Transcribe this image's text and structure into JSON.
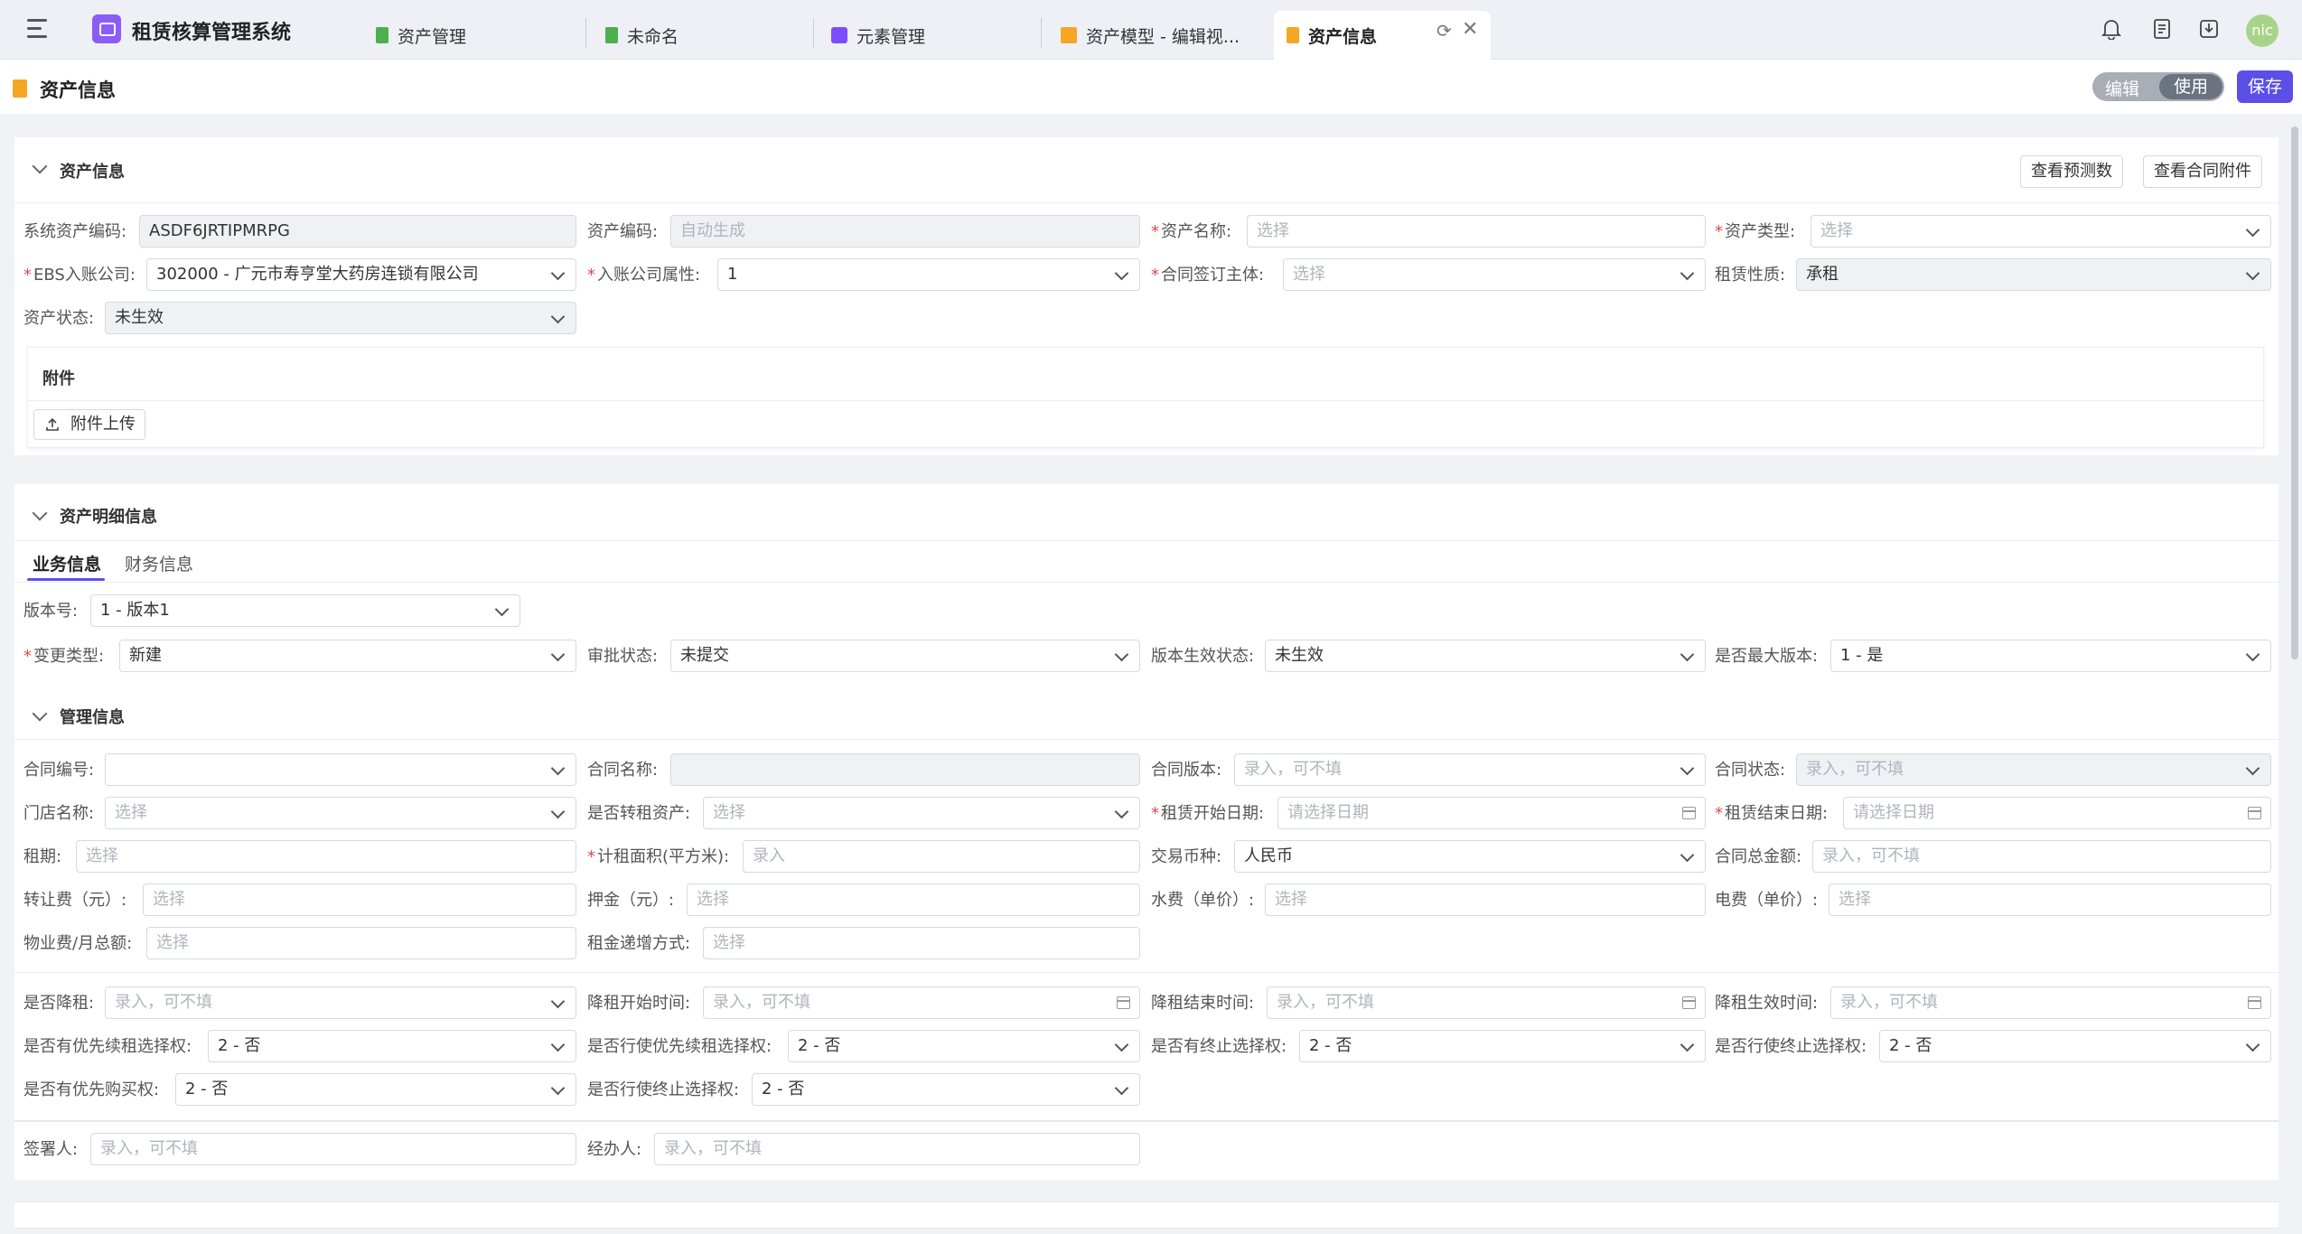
{
  "app": {
    "title": "租赁核算管理系统"
  },
  "tabs": [
    {
      "label": "资产管理",
      "color": "#4caf50"
    },
    {
      "label": "未命名",
      "color": "#4caf50"
    },
    {
      "label": "元素管理",
      "color": "#7c4dff"
    },
    {
      "label": "资产模型 - 编辑视...",
      "color": "#f5a623"
    },
    {
      "label": "资产信息",
      "color": "#f5a623"
    }
  ],
  "user": {
    "avatar": "nic"
  },
  "page": {
    "title": "资产信息",
    "mode_edit": "编辑",
    "mode_use": "使用",
    "save_label": "保存"
  },
  "asset_info": {
    "title": "资产信息",
    "btn_forecast": "查看预测数",
    "btn_contract_attach": "查看合同附件",
    "sys_code": {
      "label": "系统资产编码:",
      "value": "ASDF6JRTIPMRPG"
    },
    "asset_code": {
      "label": "资产编码:",
      "value": "自动生成"
    },
    "asset_name": {
      "label": "资产名称:",
      "value": "选择"
    },
    "asset_type": {
      "label": "资产类型:",
      "value": "选择"
    },
    "ebs_company": {
      "label": "EBS入账公司:",
      "value": "302000 - 广元市寿亨堂大药房连锁有限公司"
    },
    "company_attr": {
      "label": "入账公司属性:",
      "value": "1"
    },
    "contract_party": {
      "label": "合同签订主体:",
      "value": "选择"
    },
    "lease_nature": {
      "label": "租赁性质:",
      "value": "承租"
    },
    "asset_status": {
      "label": "资产状态:",
      "value": "未生效"
    },
    "attachment_title": "附件",
    "upload_label": "附件上传"
  },
  "detail": {
    "title": "资产明细信息",
    "tab_business": "业务信息",
    "tab_finance": "财务信息",
    "version": {
      "label": "版本号:",
      "value": "1 - 版本1"
    },
    "change_type": {
      "label": "变更类型:",
      "value": "新建"
    },
    "approval_status": {
      "label": "审批状态:",
      "value": "未提交"
    },
    "version_status": {
      "label": "版本生效状态:",
      "value": "未生效"
    },
    "is_max_version": {
      "label": "是否最大版本:",
      "value": "1 - 是"
    }
  },
  "mgmt": {
    "title": "管理信息",
    "contract_no": {
      "label": "合同编号:",
      "value": ""
    },
    "contract_name": {
      "label": "合同名称:",
      "value": ""
    },
    "contract_version": {
      "label": "合同版本:",
      "value": "录入，可不填"
    },
    "contract_status": {
      "label": "合同状态:",
      "value": "录入，可不填"
    },
    "store_name": {
      "label": "门店名称:",
      "value": "选择"
    },
    "is_sublease": {
      "label": "是否转租资产:",
      "value": "选择"
    },
    "lease_start": {
      "label": "租赁开始日期:",
      "value": "请选择日期"
    },
    "lease_end": {
      "label": "租赁结束日期:",
      "value": "请选择日期"
    },
    "lease_term": {
      "label": "租期:",
      "value": "选择"
    },
    "lease_area": {
      "label": "计租面积(平方米):",
      "value": "录入"
    },
    "currency": {
      "label": "交易币种:",
      "value": "人民币"
    },
    "contract_total": {
      "label": "合同总金额:",
      "value": "录入，可不填"
    },
    "transfer_fee": {
      "label": "转让费（元）:",
      "value": "选择"
    },
    "deposit": {
      "label": "押金（元）:",
      "value": "选择"
    },
    "water_fee": {
      "label": "水费（单价）:",
      "value": "选择"
    },
    "power_fee": {
      "label": "电费（单价）:",
      "value": "选择"
    },
    "property_fee": {
      "label": "物业费/月总额:",
      "value": "选择"
    },
    "rent_increase": {
      "label": "租金递增方式:",
      "value": "选择"
    },
    "is_rent_reduce": {
      "label": "是否降租:",
      "value": "录入，可不填"
    },
    "reduce_start": {
      "label": "降租开始时间:",
      "value": "录入，可不填"
    },
    "reduce_end": {
      "label": "降租结束时间:",
      "value": "录入，可不填"
    },
    "reduce_effective": {
      "label": "降租生效时间:",
      "value": "录入，可不填"
    },
    "renew_option": {
      "label": "是否有优先续租选择权:",
      "value": "2 - 否"
    },
    "exercise_renew": {
      "label": "是否行使优先续租选择权:",
      "value": "2 - 否"
    },
    "terminate_option": {
      "label": "是否有终止选择权:",
      "value": "2 - 否"
    },
    "exercise_terminate": {
      "label": "是否行使终止选择权:",
      "value": "2 - 否"
    },
    "purchase_option": {
      "label": "是否有优先购买权:",
      "value": "2 - 否"
    },
    "exercise_terminate2": {
      "label": "是否行使终止选择权:",
      "value": "2 - 否"
    },
    "signer": {
      "label": "签署人:",
      "value": "录入，可不填"
    },
    "handler": {
      "label": "经办人:",
      "value": "录入，可不填"
    }
  }
}
